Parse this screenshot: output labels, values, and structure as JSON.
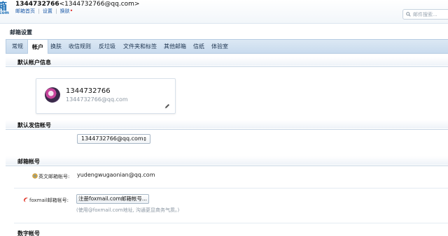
{
  "header": {
    "account_name": "1344732766",
    "account_email_bracketed": "<1344732766@qq.com>",
    "links": [
      "邮箱首页",
      "设置",
      "换肤"
    ],
    "link_separator": "|",
    "new_dot": "•",
    "logo_glyph": "箱",
    "logo_sub": "com",
    "search_placeholder": "邮件搜索..."
  },
  "panel": {
    "title": "邮箱设置",
    "tabs": [
      "常规",
      "帐户",
      "换肤",
      "收信规则",
      "反垃圾",
      "文件夹和标签",
      "其他邮箱",
      "信纸",
      "体验室"
    ],
    "active_tab": "帐户"
  },
  "default_account": {
    "heading": "默认帐户信息",
    "name": "1344732766",
    "email": "1344732766@qq.com"
  },
  "default_sender": {
    "heading": "默认发信帐号",
    "selected": "1344732766@qq.com"
  },
  "mail_accounts": {
    "heading": "邮箱帐号",
    "english_label": "英文邮箱帐号:",
    "english_value": "yudengwugaonian@qq.com",
    "foxmail_label": "foxmail邮箱帐号:",
    "foxmail_button": "注册foxmail.com邮箱帐号...",
    "foxmail_hint": "(使用@foxmail.com地址, 沟通更显商务气质。)"
  },
  "numeric_accounts": {
    "heading": "数字帐号"
  },
  "colors": {
    "accent": "#1c6fb6",
    "tab_bar": "#c9dbee",
    "link": "#1c5aa8"
  },
  "icons": {
    "search": "search-icon",
    "edit": "pencil-icon",
    "dropdown": "chevron-updown-icon",
    "english_account": "globe-icon",
    "foxmail": "foxmail-logo-icon"
  }
}
